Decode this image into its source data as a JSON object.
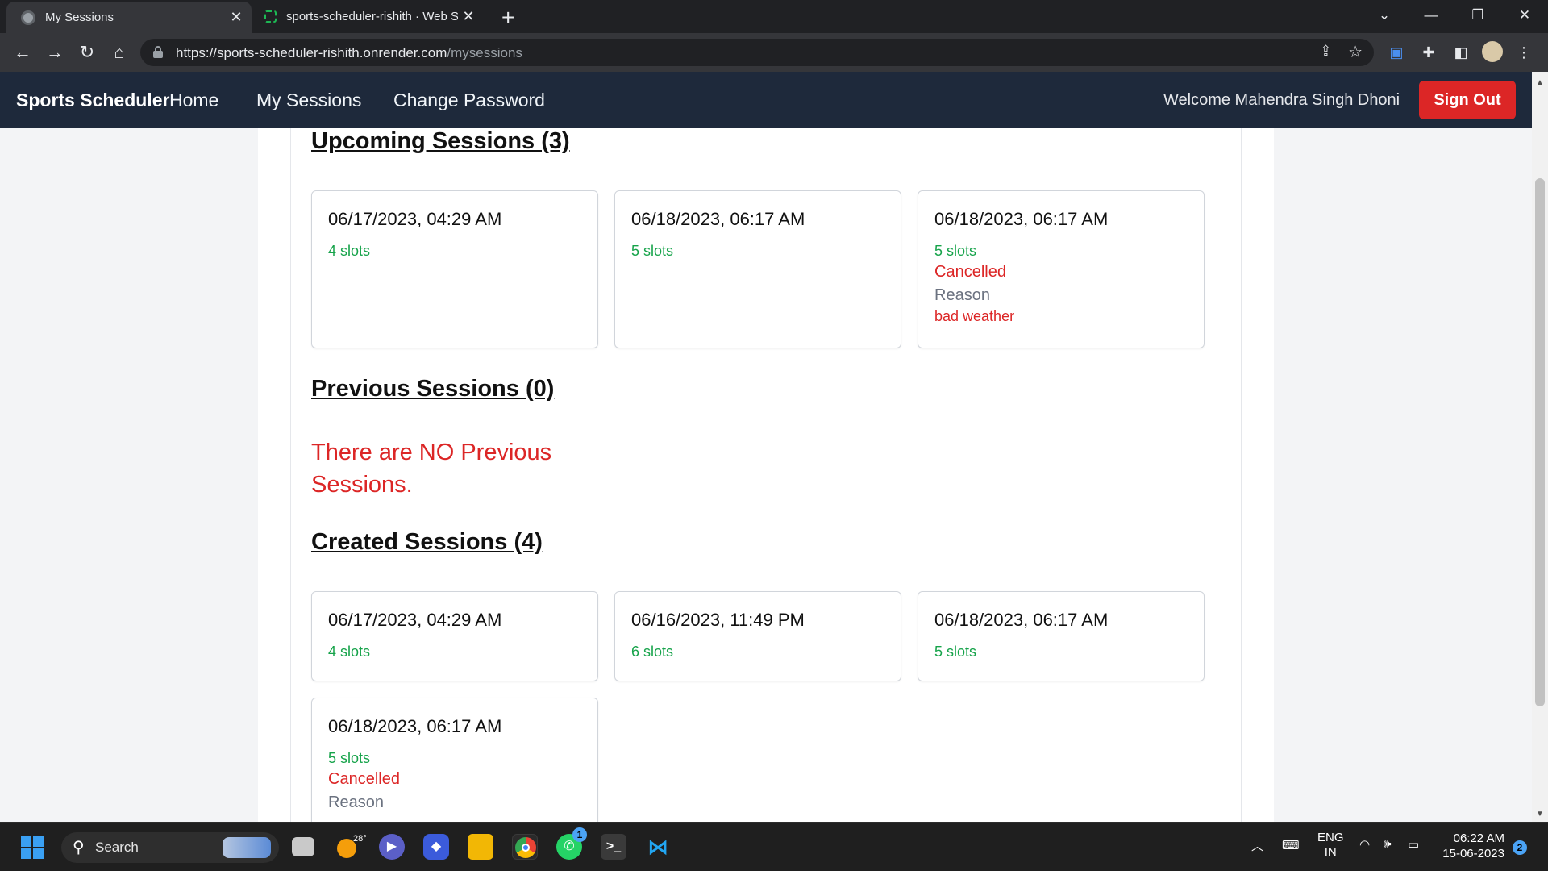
{
  "browser": {
    "tabs": [
      {
        "title": "My Sessions",
        "active": true
      },
      {
        "title": "sports-scheduler-rishith · Web Se",
        "active": false
      }
    ],
    "url_host": "https://sports-scheduler-rishith.onrender.com",
    "url_path": "/mysessions",
    "icons": {
      "back": "arrow-left-icon",
      "forward": "arrow-right-icon",
      "reload": "reload-icon",
      "home": "home-icon",
      "share": "share-icon",
      "bookmark": "star-icon",
      "extensions": "puzzle-icon"
    }
  },
  "nav": {
    "brand": "Sports Scheduler",
    "links": [
      "Home",
      "My Sessions",
      "Change Password"
    ],
    "welcome": "Welcome Mahendra Singh Dhoni",
    "signout": "Sign Out"
  },
  "upcoming": {
    "title": "Upcoming Sessions (3)",
    "cards": [
      {
        "datetime": "06/17/2023, 04:29 AM",
        "slots": "4 slots"
      },
      {
        "datetime": "06/18/2023, 06:17 AM",
        "slots": "5 slots"
      },
      {
        "datetime": "06/18/2023, 06:17 AM",
        "slots": "5 slots",
        "status": "Cancelled",
        "reason_label": "Reason",
        "reason": "bad weather"
      }
    ]
  },
  "previous": {
    "title": "Previous Sessions (0)",
    "empty_message": "There are NO Previous Sessions."
  },
  "created": {
    "title": "Created Sessions (4)",
    "cards": [
      {
        "datetime": "06/17/2023, 04:29 AM",
        "slots": "4 slots"
      },
      {
        "datetime": "06/16/2023, 11:49 PM",
        "slots": "6 slots"
      },
      {
        "datetime": "06/18/2023, 06:17 AM",
        "slots": "5 slots"
      },
      {
        "datetime": "06/18/2023, 06:17 AM",
        "slots": "5 slots",
        "status": "Cancelled",
        "reason_label": "Reason"
      }
    ]
  },
  "taskbar": {
    "search_label": "Search",
    "weather_temp": "28°",
    "whatsapp_badge": "1",
    "lang_top": "ENG",
    "lang_bottom": "IN",
    "time": "06:22 AM",
    "date": "15-06-2023",
    "notification_count": "2"
  },
  "colors": {
    "navbar": "#1e293b",
    "signout": "#dc2626",
    "slots": "#16a34a",
    "cancelled": "#dc2626"
  }
}
